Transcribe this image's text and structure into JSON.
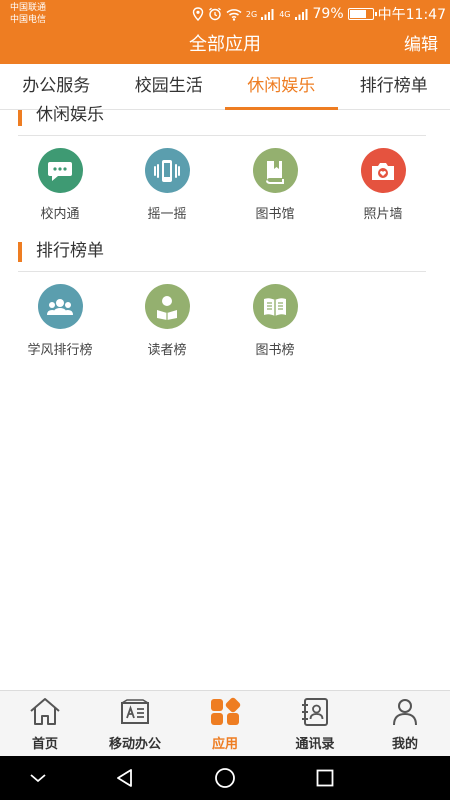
{
  "status_bar": {
    "carrier1": "中国联通",
    "carrier2": "中国电信",
    "net1": "2G",
    "net2": "4G",
    "battery": "79%",
    "battery_level": 0.79,
    "time": "中午11:47"
  },
  "header": {
    "title": "全部应用",
    "edit_label": "编辑"
  },
  "tabs": [
    {
      "label": "办公服务",
      "active": false
    },
    {
      "label": "校园生活",
      "active": false
    },
    {
      "label": "休闲娱乐",
      "active": true
    },
    {
      "label": "排行榜单",
      "active": false
    }
  ],
  "sections": [
    {
      "title": "休闲娱乐",
      "apps": [
        {
          "label": "校内通",
          "icon": "chat-bubble-icon",
          "color": "#3e9a73"
        },
        {
          "label": "摇一摇",
          "icon": "phone-shake-icon",
          "color": "#5b9eae"
        },
        {
          "label": "图书馆",
          "icon": "book-icon",
          "color": "#94b06f"
        },
        {
          "label": "照片墙",
          "icon": "camera-icon",
          "color": "#e5533f"
        }
      ]
    },
    {
      "title": "排行榜单",
      "apps": [
        {
          "label": "学风排行榜",
          "icon": "people-group-icon",
          "color": "#5b9eae"
        },
        {
          "label": "读者榜",
          "icon": "reader-icon",
          "color": "#94b06f"
        },
        {
          "label": "图书榜",
          "icon": "open-book-icon",
          "color": "#94b06f"
        }
      ]
    }
  ],
  "bottom_nav": [
    {
      "label": "首页",
      "icon": "home-icon",
      "active": false
    },
    {
      "label": "移动办公",
      "icon": "id-card-icon",
      "active": false
    },
    {
      "label": "应用",
      "icon": "apps-grid-icon",
      "active": true
    },
    {
      "label": "通讯录",
      "icon": "contacts-icon",
      "active": false
    },
    {
      "label": "我的",
      "icon": "user-icon",
      "active": false
    }
  ],
  "colors": {
    "accent": "#ee7d22",
    "system_nav": "#000000"
  }
}
